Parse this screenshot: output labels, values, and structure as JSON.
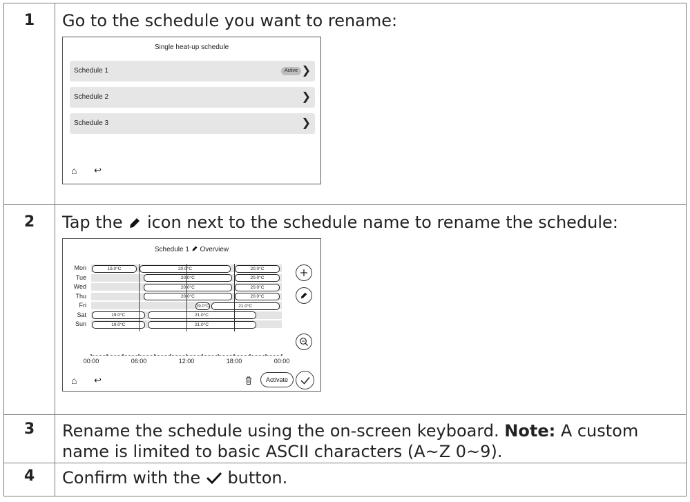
{
  "steps": [
    {
      "number": "1",
      "text": "Go to the schedule you want to rename:"
    },
    {
      "number": "2",
      "text_before": "Tap the",
      "text_after": "icon next to the schedule name to rename the schedule:",
      "icon": "pencil-icon"
    },
    {
      "number": "3",
      "text_before": "Rename the schedule using the on-screen keyboard. ",
      "note_label": "Note:",
      "text_after": " A custom name is limited to basic ASCII characters (A~Z 0~9)."
    },
    {
      "number": "4",
      "text_before": "Confirm with the",
      "text_after": "button.",
      "icon": "checkmark-icon"
    }
  ],
  "screen1": {
    "title": "Single heat-up schedule",
    "items": [
      {
        "label": "Schedule 1",
        "badge": "Active",
        "icon": "chevron-right-icon"
      },
      {
        "label": "Schedule 2",
        "icon": "chevron-right-icon"
      },
      {
        "label": "Schedule 3",
        "icon": "chevron-right-icon"
      }
    ],
    "nav_icons": [
      "home-icon",
      "back-icon"
    ]
  },
  "screen2": {
    "title": "Schedule 1",
    "title_suffix": "Overview",
    "days": [
      {
        "label": "Mon",
        "segments": [
          {
            "start": "00:00",
            "temp": "19.0°C"
          },
          {
            "start": "06:00",
            "temp": "20.0°C"
          },
          {
            "start": "18:00",
            "temp": "20.0°C"
          }
        ]
      },
      {
        "label": "Tue",
        "segments": [
          {
            "start": "06:30",
            "temp": "20.0°C"
          },
          {
            "start": "18:00",
            "temp": "20.0°C"
          }
        ]
      },
      {
        "label": "Wed",
        "segments": [
          {
            "start": "06:30",
            "temp": "20.0°C"
          },
          {
            "start": "18:00",
            "temp": "20.0°C"
          }
        ]
      },
      {
        "label": "Thu",
        "segments": [
          {
            "start": "06:30",
            "temp": "20.0°C"
          },
          {
            "start": "18:00",
            "temp": "20.0°C"
          }
        ]
      },
      {
        "label": "Fri",
        "segments": [
          {
            "start": "13:00",
            "temp": "19.0°C"
          },
          {
            "start": "15:00",
            "temp": "21.0°C"
          }
        ]
      },
      {
        "label": "Sat",
        "segments": [
          {
            "start": "00:00",
            "temp": "19.0°C"
          },
          {
            "start": "07:00",
            "temp": "21.0°C"
          }
        ]
      },
      {
        "label": "Sun",
        "segments": [
          {
            "start": "00:00",
            "temp": "19.0°C"
          },
          {
            "start": "07:00",
            "temp": "21.0°C"
          }
        ]
      }
    ],
    "time_axis": [
      "00:00",
      "06:00",
      "12:00",
      "18:00",
      "00:00"
    ],
    "side_buttons": [
      "add-icon",
      "edit-icon",
      "zoom-icon"
    ],
    "activate_label": "Activate",
    "bottom_icons": [
      "home-icon",
      "back-icon",
      "trash-icon",
      "checkmark-icon"
    ]
  }
}
